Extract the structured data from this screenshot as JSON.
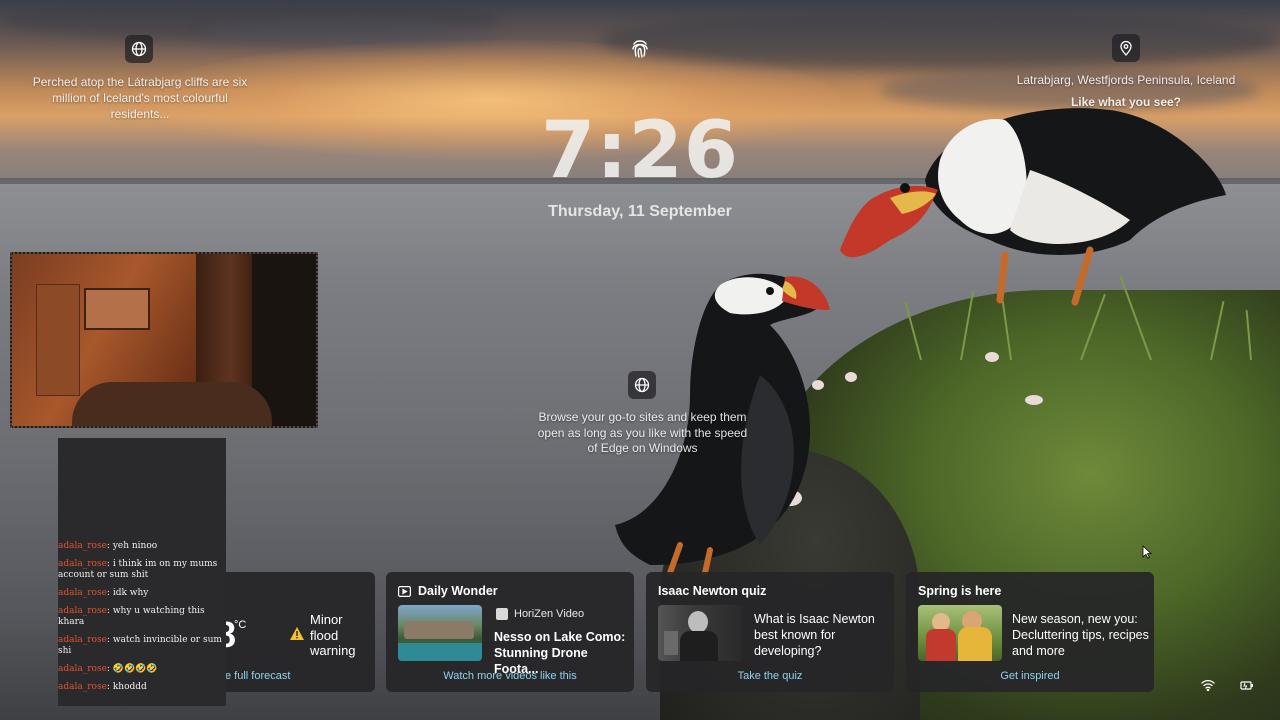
{
  "top_left": {
    "icon": "globe-icon",
    "text_line1": "Perched atop the Látrabjarg cliffs are six",
    "text_line2": "million of Iceland's most colourful",
    "text_line3": "residents..."
  },
  "top_center": {
    "icon": "fingerprint-icon"
  },
  "top_right": {
    "icon": "location-pin-icon",
    "location": "Latrabjarg, Westfjords Peninsula, Iceland",
    "prompt": "Like what you see?"
  },
  "clock": {
    "time": "7:26",
    "date": "Thursday, 11 September"
  },
  "edge_promo": {
    "icon": "globe-icon",
    "line1": "Browse your go-to sites and keep them",
    "line2": "open as long as you like with the speed",
    "line3": "of Edge on Windows"
  },
  "chat": {
    "messages": [
      {
        "user": "adala_rose",
        "text": "yeh ninoo"
      },
      {
        "user": "adala_rose",
        "text": "i think im on my mums account or sum shit"
      },
      {
        "user": "adala_rose",
        "text": "idk why"
      },
      {
        "user": "adala_rose",
        "text": "why u watching this khara"
      },
      {
        "user": "adala_rose",
        "text": "watch invincible or sum shi"
      },
      {
        "user": "adala_rose",
        "text": "🤣🤣🤣🤣"
      },
      {
        "user": "adala_rose",
        "text": "khoddd"
      }
    ]
  },
  "weather_card": {
    "temp_unit": "°C",
    "warning_line1": "Minor",
    "warning_line2": "flood",
    "warning_line3": "warning",
    "link": "e full forecast"
  },
  "video_card": {
    "title": "Daily Wonder",
    "source": "HoriZen Video",
    "headline_line1": "Nesso on Lake Como:",
    "headline_line2": "Stunning Drone Foota...",
    "link": "Watch more videos like this"
  },
  "quiz_card": {
    "title": "Isaac Newton quiz",
    "line1": "What is Isaac Newton",
    "line2": "best known for",
    "line3": "developing?",
    "link": "Take the quiz"
  },
  "spring_card": {
    "title": "Spring is here",
    "line1": "New season, new you:",
    "line2": "Decluttering tips, recipes",
    "line3": "and more",
    "link": "Get inspired"
  },
  "tray": {
    "wifi_icon": "wifi-icon",
    "battery_icon": "battery-icon"
  },
  "colors": {
    "link": "#8fd2f0",
    "chat_user": "#e2512e",
    "card_bg": "#262628"
  }
}
